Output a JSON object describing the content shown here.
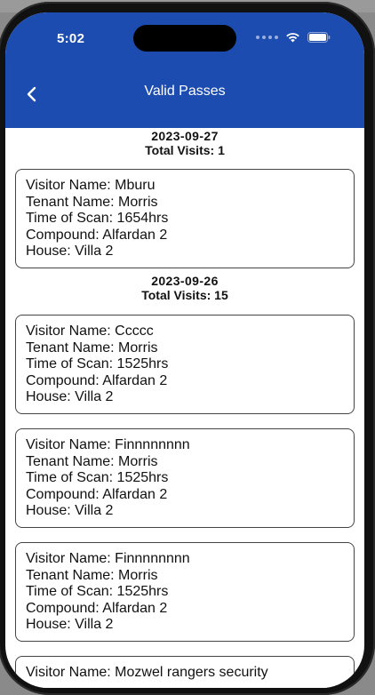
{
  "status_bar": {
    "time": "5:02"
  },
  "header": {
    "title": "Valid Passes"
  },
  "groups": [
    {
      "date": "2023-09-27",
      "total_visits": "Total Visits: 1",
      "passes": [
        {
          "visitor": "Visitor Name: Mburu",
          "tenant": "Tenant Name: Morris",
          "time": "Time of Scan: 1654hrs",
          "compound": "Compound: Alfardan 2",
          "house": "House: Villa 2"
        }
      ]
    },
    {
      "date": "2023-09-26",
      "total_visits": "Total Visits: 15",
      "passes": [
        {
          "visitor": "Visitor Name: Ccccc",
          "tenant": "Tenant Name: Morris",
          "time": "Time of Scan: 1525hrs",
          "compound": "Compound: Alfardan 2",
          "house": "House: Villa 2"
        },
        {
          "visitor": "Visitor Name: Finnnnnnnn",
          "tenant": "Tenant Name: Morris",
          "time": "Time of Scan: 1525hrs",
          "compound": "Compound: Alfardan 2",
          "house": "House: Villa 2"
        },
        {
          "visitor": "Visitor Name: Finnnnnnnn",
          "tenant": "Tenant Name: Morris",
          "time": "Time of Scan: 1525hrs",
          "compound": "Compound: Alfardan 2",
          "house": "House: Villa 2"
        },
        {
          "visitor": "Visitor Name: Mozwel rangers security"
        }
      ]
    }
  ],
  "colors": {
    "header": "#1c4cb0",
    "card_border": "#444444",
    "background": "#ffffff"
  },
  "icons": {
    "back": "chevron-left-icon",
    "wifi": "wifi-icon",
    "battery": "battery-icon",
    "signal": "signal-dots-icon"
  }
}
